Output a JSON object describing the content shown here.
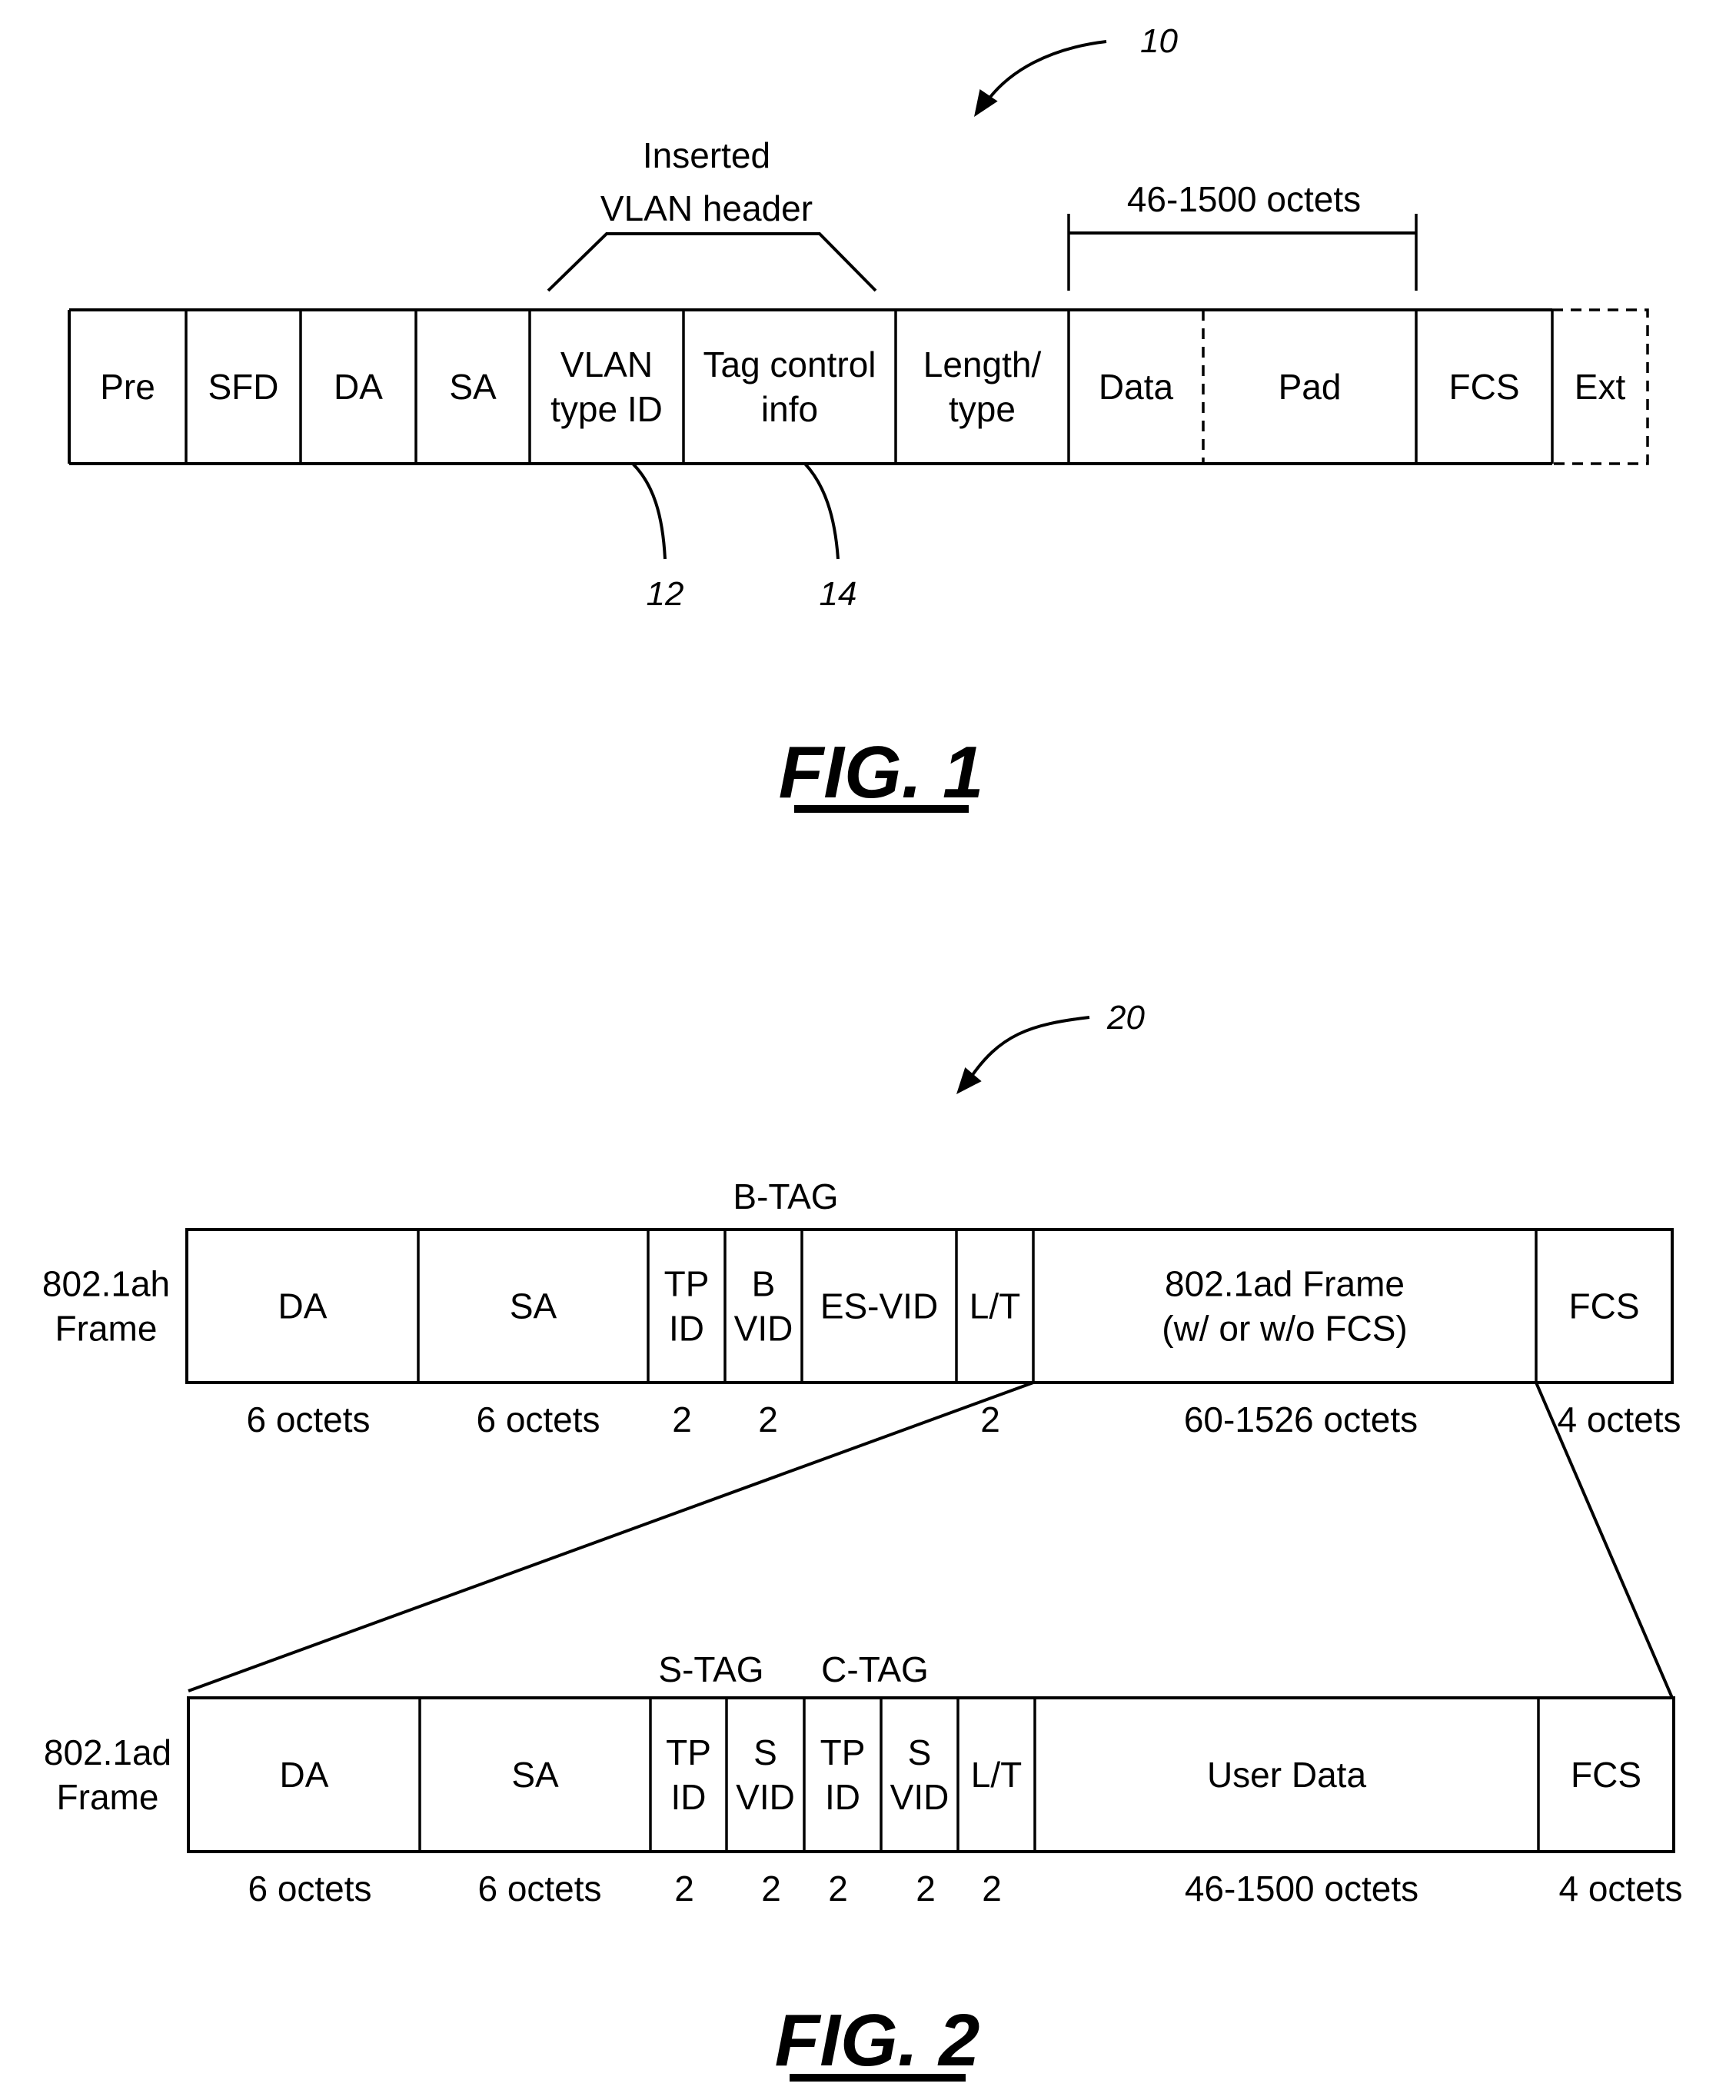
{
  "fig1": {
    "reference": "10",
    "header_bracket_label": [
      "Inserted",
      "VLAN header"
    ],
    "data_bracket_label": "46-1500 octets",
    "fields": [
      {
        "name": "pre",
        "label": [
          "Pre"
        ],
        "border": "solid"
      },
      {
        "name": "sfd",
        "label": [
          "SFD"
        ],
        "border": "solid"
      },
      {
        "name": "da",
        "label": [
          "DA"
        ],
        "border": "solid"
      },
      {
        "name": "sa",
        "label": [
          "SA"
        ],
        "border": "solid"
      },
      {
        "name": "vlan-type-id",
        "label": [
          "VLAN",
          "type ID"
        ],
        "border": "solid",
        "reference": "12"
      },
      {
        "name": "tag-control-info",
        "label": [
          "Tag control",
          "info"
        ],
        "border": "solid",
        "reference": "14"
      },
      {
        "name": "length-type",
        "label": [
          "Length/",
          "type"
        ],
        "border": "solid"
      },
      {
        "name": "data",
        "label": [
          "Data"
        ],
        "border": "dashed-right"
      },
      {
        "name": "pad",
        "label": [
          "Pad"
        ],
        "border": "solid"
      },
      {
        "name": "fcs",
        "label": [
          "FCS"
        ],
        "border": "solid"
      },
      {
        "name": "ext",
        "label": [
          "Ext"
        ],
        "border": "dashed"
      }
    ],
    "caption": "FIG. 1"
  },
  "fig2": {
    "reference": "20",
    "ah_frame": {
      "row_label": [
        "802.1ah",
        "Frame"
      ],
      "group_labels": [
        {
          "name": "b-tag",
          "label": "B-TAG"
        }
      ],
      "fields": [
        {
          "name": "da",
          "label": [
            "DA"
          ],
          "size": "6 octets"
        },
        {
          "name": "sa",
          "label": [
            "SA"
          ],
          "size": "6 octets"
        },
        {
          "name": "tp-id",
          "label": [
            "TP",
            "ID"
          ],
          "size": "2"
        },
        {
          "name": "b-vid",
          "label": [
            "B",
            "VID"
          ],
          "size": "2"
        },
        {
          "name": "es-vid",
          "label": [
            "ES-VID"
          ],
          "size": ""
        },
        {
          "name": "lt",
          "label": [
            "L/T"
          ],
          "size": "2"
        },
        {
          "name": "ad-frame",
          "label": [
            "802.1ad Frame",
            "(w/ or w/o FCS)"
          ],
          "size": "60-1526 octets"
        },
        {
          "name": "fcs",
          "label": [
            "FCS"
          ],
          "size": "4 octets"
        }
      ]
    },
    "ad_frame": {
      "row_label": [
        "802.1ad",
        "Frame"
      ],
      "group_labels": [
        {
          "name": "s-tag",
          "label": "S-TAG"
        },
        {
          "name": "c-tag",
          "label": "C-TAG"
        }
      ],
      "fields": [
        {
          "name": "da",
          "label": [
            "DA"
          ],
          "size": "6 octets"
        },
        {
          "name": "sa",
          "label": [
            "SA"
          ],
          "size": "6 octets"
        },
        {
          "name": "s-tp-id",
          "label": [
            "TP",
            "ID"
          ],
          "size": "2"
        },
        {
          "name": "s-vid",
          "label": [
            "S",
            "VID"
          ],
          "size": "2"
        },
        {
          "name": "c-tp-id",
          "label": [
            "TP",
            "ID"
          ],
          "size": "2"
        },
        {
          "name": "c-vid",
          "label": [
            "S",
            "VID"
          ],
          "size": "2"
        },
        {
          "name": "lt",
          "label": [
            "L/T"
          ],
          "size": "2"
        },
        {
          "name": "user-data",
          "label": [
            "User Data"
          ],
          "size": "46-1500 octets"
        },
        {
          "name": "fcs",
          "label": [
            "FCS"
          ],
          "size": "4 octets"
        }
      ]
    },
    "caption": "FIG. 2"
  }
}
